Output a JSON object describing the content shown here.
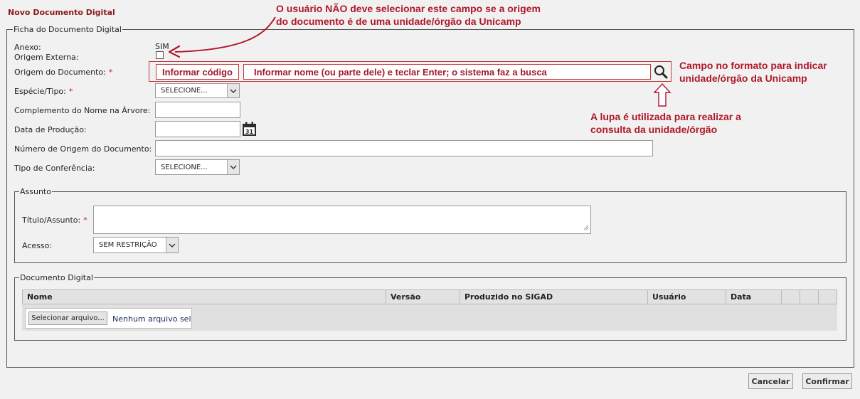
{
  "page": {
    "title": "Novo Documento Digital"
  },
  "ficha": {
    "legend": "Ficha do Documento Digital",
    "anexo_label": "Anexo:",
    "anexo_value": "SIM",
    "origem_externa_label": "Origem Externa:",
    "origem_documento_label": "Origem do Documento:",
    "required_mark": "*",
    "codigo_placeholder": "Informar código",
    "nome_placeholder": "Informar nome (ou parte dele) e teclar Enter; o sistema faz a busca",
    "especie_label": "Espécie/Tipo:",
    "especie_value": "SELECIONE...",
    "complemento_label": "Complemento do Nome na Árvore:",
    "data_producao_label": "Data de Produção:",
    "calendar_day": "31",
    "numero_origem_label": "Número de Origem do Documento:",
    "tipo_conferencia_label": "Tipo de Conferência:",
    "tipo_conferencia_value": "SELECIONE..."
  },
  "assunto": {
    "legend": "Assunto",
    "titulo_label": "Título/Assunto:",
    "acesso_label": "Acesso:",
    "acesso_value": "SEM RESTRIÇÃO"
  },
  "documento_digital": {
    "legend": "Documento Digital",
    "columns": [
      "Nome",
      "Versão",
      "Produzido no SIGAD",
      "Usuário",
      "Data",
      "",
      "",
      ""
    ],
    "file_button": "Selecionar arquivo...",
    "file_status": "Nenhum arquivo sel"
  },
  "annotations": {
    "top_line1": "O usuário NÃO deve selecionar este campo se a origem",
    "top_line2": "do documento é de uma unidade/órgão da Unicamp",
    "right_line1": "Campo no formato para indicar",
    "right_line2": "unidade/órgão da Unicamp",
    "lupa_line1": "A lupa é utilizada para realizar a",
    "lupa_line2": "consulta da unidade/órgão"
  },
  "actions": {
    "cancel": "Cancelar",
    "confirm": "Confirmar"
  },
  "colors": {
    "annotation_red": "#b0182a",
    "title_red": "#8b1a1a",
    "background": "#f1f1f1"
  },
  "icons": [
    "search-icon",
    "calendar-icon",
    "chevron-down-icon",
    "arrow-up-outline-icon",
    "curved-arrow-icon",
    "resize-grip-icon"
  ]
}
